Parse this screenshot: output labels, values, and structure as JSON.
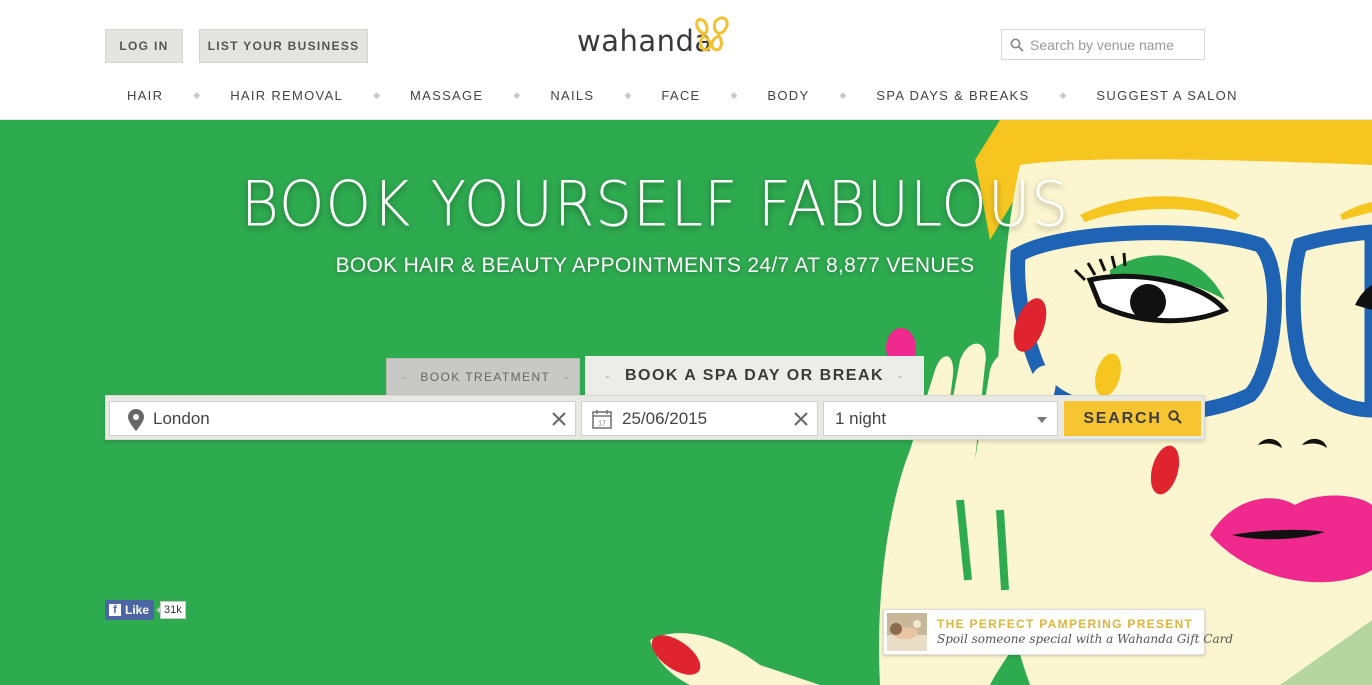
{
  "header": {
    "login_label": "LOG IN",
    "list_business_label": "LIST YOUR BUSINESS",
    "logo_text": "wahanda",
    "venue_search_placeholder": "Search by venue name"
  },
  "nav": {
    "items": [
      {
        "label": "HAIR"
      },
      {
        "label": "HAIR REMOVAL"
      },
      {
        "label": "MASSAGE"
      },
      {
        "label": "NAILS"
      },
      {
        "label": "FACE"
      },
      {
        "label": "BODY"
      },
      {
        "label": "SPA DAYS & BREAKS"
      },
      {
        "label": "SUGGEST A SALON"
      }
    ],
    "separator": "◆"
  },
  "hero": {
    "headline": "BOOK YOURSELF FABULOUS",
    "subheadline": "BOOK HAIR & BEAUTY APPOINTMENTS 24/7 AT 8,877 VENUES",
    "background_color": "#2eaa4f"
  },
  "booking": {
    "tabs": [
      {
        "label": "BOOK TREATMENT",
        "active": false
      },
      {
        "label": "BOOK A SPA DAY OR BREAK",
        "active": true
      }
    ],
    "tab_dash": "-",
    "location_value": "London",
    "date_value": "25/06/2015",
    "calendar_day": "17",
    "nights_value": "1 night",
    "search_label": "SEARCH",
    "accent_color": "#f7c531"
  },
  "facebook": {
    "like_label": "Like",
    "like_icon": "f",
    "count": "31k"
  },
  "gift_card": {
    "title": "THE PERFECT PAMPERING PRESENT",
    "subtitle": "Spoil someone special with a Wahanda Gift Card"
  },
  "icons": {
    "venue_search": "search-icon",
    "location": "map-pin-icon",
    "date": "calendar-icon",
    "clear": "close-icon",
    "nights": "chevron-down-icon",
    "search_button": "search-icon"
  }
}
